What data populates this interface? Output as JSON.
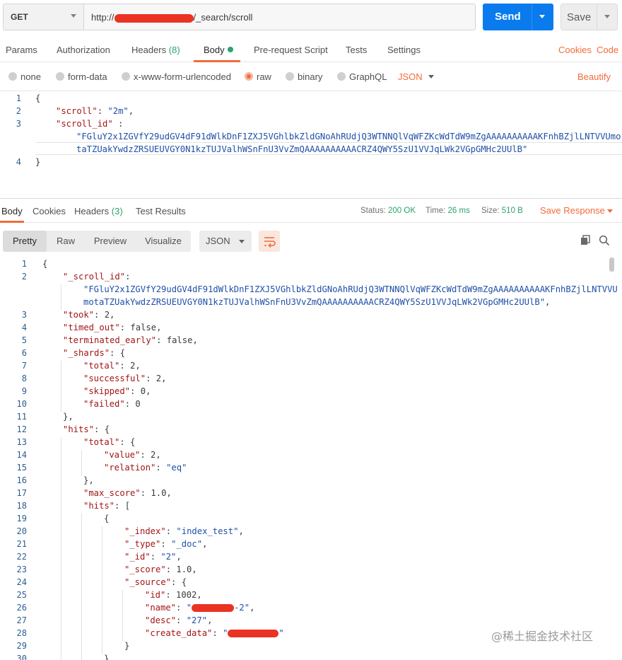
{
  "request": {
    "method": "GET",
    "url_prefix": "http://",
    "url_suffix": "/_search/scroll",
    "send_label": "Send",
    "save_label": "Save"
  },
  "request_tabs": [
    {
      "label": "Params"
    },
    {
      "label": "Authorization"
    },
    {
      "label": "Headers",
      "count": "(8)"
    },
    {
      "label": "Body"
    },
    {
      "label": "Pre-request Script"
    },
    {
      "label": "Tests"
    },
    {
      "label": "Settings"
    }
  ],
  "links": {
    "cookies": "Cookies",
    "code": "Code",
    "beautify": "Beautify"
  },
  "body_types": [
    {
      "label": "none"
    },
    {
      "label": "form-data"
    },
    {
      "label": "x-www-form-urlencoded"
    },
    {
      "label": "raw"
    },
    {
      "label": "binary"
    },
    {
      "label": "GraphQL"
    }
  ],
  "body_format": "JSON",
  "request_body": {
    "line_numbers": [
      "1",
      "2",
      "3",
      "4"
    ],
    "scroll_key": "\"scroll\"",
    "scroll_value": "\"2m\"",
    "scroll_id_key": "\"scroll_id\"",
    "scroll_id_value_1": "\"FGluY2x1ZGVfY29udGV4dF91dWlkDnF1ZXJ5VGhlbkZldGNoAhRUdjQ3WTNNQlVqWFZKcWdTdW9mZgAAAAAAAAAAKFnhBZjlLNTVVUmo",
    "scroll_id_value_2": "taTZUakYwdzZRSUEUVGY0N1kzTUJValhWSnFnU3VvZmQAAAAAAAAAACRZ4QWY5SzU1VVJqLWk2VGpGMHc2UUlB\""
  },
  "response_tabs": [
    {
      "label": "Body"
    },
    {
      "label": "Cookies"
    },
    {
      "label": "Headers",
      "count": "(3)"
    },
    {
      "label": "Test Results"
    }
  ],
  "response_status": {
    "status_label": "Status:",
    "status_value": "200 OK",
    "time_label": "Time:",
    "time_value": "26 ms",
    "size_label": "Size:",
    "size_value": "510 B",
    "save_response": "Save Response"
  },
  "view_modes": [
    "Pretty",
    "Raw",
    "Preview",
    "Visualize"
  ],
  "response_format": "JSON",
  "response_lines": [
    {
      "n": "1",
      "indent": 0,
      "parts": [
        [
          "p",
          "{"
        ]
      ]
    },
    {
      "n": "2",
      "indent": 1,
      "parts": [
        [
          "k",
          "\"_scroll_id\""
        ],
        [
          "p",
          ":"
        ]
      ]
    },
    {
      "n": "",
      "indent": 2,
      "parts": [
        [
          "s",
          "\"FGluY2x1ZGVfY29udGV4dF91dWlkDnF1ZXJ5VGhlbkZldGNoAhRUdjQ3WTNNQlVqWFZKcWdTdW9mZgAAAAAAAAAAKFnhBZjlLNTVVU"
        ]
      ]
    },
    {
      "n": "",
      "indent": 2,
      "parts": [
        [
          "s",
          "motaTZUakYwdzZRSUEUVGY0N1kzTUJValhWSnFnU3VvZmQAAAAAAAAAACRZ4QWY5SzU1VVJqLWk2VGpGMHc2UUlB\""
        ],
        [
          "p",
          ","
        ]
      ]
    },
    {
      "n": "3",
      "indent": 1,
      "parts": [
        [
          "k",
          "\"took\""
        ],
        [
          "p",
          ": 2,"
        ]
      ]
    },
    {
      "n": "4",
      "indent": 1,
      "parts": [
        [
          "k",
          "\"timed_out\""
        ],
        [
          "p",
          ": false,"
        ]
      ]
    },
    {
      "n": "5",
      "indent": 1,
      "parts": [
        [
          "k",
          "\"terminated_early\""
        ],
        [
          "p",
          ": false,"
        ]
      ]
    },
    {
      "n": "6",
      "indent": 1,
      "parts": [
        [
          "k",
          "\"_shards\""
        ],
        [
          "p",
          ": {"
        ]
      ]
    },
    {
      "n": "7",
      "indent": 2,
      "parts": [
        [
          "k",
          "\"total\""
        ],
        [
          "p",
          ": 2,"
        ]
      ]
    },
    {
      "n": "8",
      "indent": 2,
      "parts": [
        [
          "k",
          "\"successful\""
        ],
        [
          "p",
          ": 2,"
        ]
      ]
    },
    {
      "n": "9",
      "indent": 2,
      "parts": [
        [
          "k",
          "\"skipped\""
        ],
        [
          "p",
          ": 0,"
        ]
      ]
    },
    {
      "n": "10",
      "indent": 2,
      "parts": [
        [
          "k",
          "\"failed\""
        ],
        [
          "p",
          ": 0"
        ]
      ]
    },
    {
      "n": "11",
      "indent": 1,
      "parts": [
        [
          "p",
          "},"
        ]
      ]
    },
    {
      "n": "12",
      "indent": 1,
      "parts": [
        [
          "k",
          "\"hits\""
        ],
        [
          "p",
          ": {"
        ]
      ]
    },
    {
      "n": "13",
      "indent": 2,
      "parts": [
        [
          "k",
          "\"total\""
        ],
        [
          "p",
          ": {"
        ]
      ]
    },
    {
      "n": "14",
      "indent": 3,
      "parts": [
        [
          "k",
          "\"value\""
        ],
        [
          "p",
          ": 2,"
        ]
      ]
    },
    {
      "n": "15",
      "indent": 3,
      "parts": [
        [
          "k",
          "\"relation\""
        ],
        [
          "p",
          ": "
        ],
        [
          "s",
          "\"eq\""
        ]
      ]
    },
    {
      "n": "16",
      "indent": 2,
      "parts": [
        [
          "p",
          "},"
        ]
      ]
    },
    {
      "n": "17",
      "indent": 2,
      "parts": [
        [
          "k",
          "\"max_score\""
        ],
        [
          "p",
          ": 1.0,"
        ]
      ]
    },
    {
      "n": "18",
      "indent": 2,
      "parts": [
        [
          "k",
          "\"hits\""
        ],
        [
          "p",
          ": ["
        ]
      ]
    },
    {
      "n": "19",
      "indent": 3,
      "parts": [
        [
          "p",
          "{"
        ]
      ]
    },
    {
      "n": "20",
      "indent": 4,
      "parts": [
        [
          "k",
          "\"_index\""
        ],
        [
          "p",
          ": "
        ],
        [
          "s",
          "\"index_test\""
        ],
        [
          "p",
          ","
        ]
      ]
    },
    {
      "n": "21",
      "indent": 4,
      "parts": [
        [
          "k",
          "\"_type\""
        ],
        [
          "p",
          ": "
        ],
        [
          "s",
          "\"_doc\""
        ],
        [
          "p",
          ","
        ]
      ]
    },
    {
      "n": "22",
      "indent": 4,
      "parts": [
        [
          "k",
          "\"_id\""
        ],
        [
          "p",
          ": "
        ],
        [
          "s",
          "\"2\""
        ],
        [
          "p",
          ","
        ]
      ]
    },
    {
      "n": "23",
      "indent": 4,
      "parts": [
        [
          "k",
          "\"_score\""
        ],
        [
          "p",
          ": 1.0,"
        ]
      ]
    },
    {
      "n": "24",
      "indent": 4,
      "parts": [
        [
          "k",
          "\"_source\""
        ],
        [
          "p",
          ": {"
        ]
      ]
    },
    {
      "n": "25",
      "indent": 5,
      "parts": [
        [
          "k",
          "\"id\""
        ],
        [
          "p",
          ": 1002,"
        ]
      ]
    },
    {
      "n": "26",
      "indent": 5,
      "parts": [
        [
          "k",
          "\"name\""
        ],
        [
          "p",
          ": "
        ],
        [
          "s",
          "\""
        ],
        [
          "r",
          "RED60"
        ],
        [
          "s",
          "-2\""
        ],
        [
          "p",
          ","
        ]
      ]
    },
    {
      "n": "27",
      "indent": 5,
      "parts": [
        [
          "k",
          "\"desc\""
        ],
        [
          "p",
          ": "
        ],
        [
          "s",
          "\"27\""
        ],
        [
          "p",
          ","
        ]
      ]
    },
    {
      "n": "28",
      "indent": 5,
      "parts": [
        [
          "k",
          "\"create_data\""
        ],
        [
          "p",
          ": "
        ],
        [
          "s",
          "\""
        ],
        [
          "r",
          "RED72"
        ],
        [
          "s",
          "\""
        ]
      ]
    },
    {
      "n": "29",
      "indent": 4,
      "parts": [
        [
          "p",
          "}"
        ]
      ]
    },
    {
      "n": "30",
      "indent": 3,
      "parts": [
        [
          "p",
          "}"
        ]
      ]
    }
  ],
  "watermark": "@稀土掘金技术社区",
  "colors": {
    "accent": "#f26b3a",
    "send": "#097bed",
    "ok": "#2aa56b",
    "key": "#a31515",
    "string": "#1f4fa8",
    "redaction": "#ea3323"
  }
}
